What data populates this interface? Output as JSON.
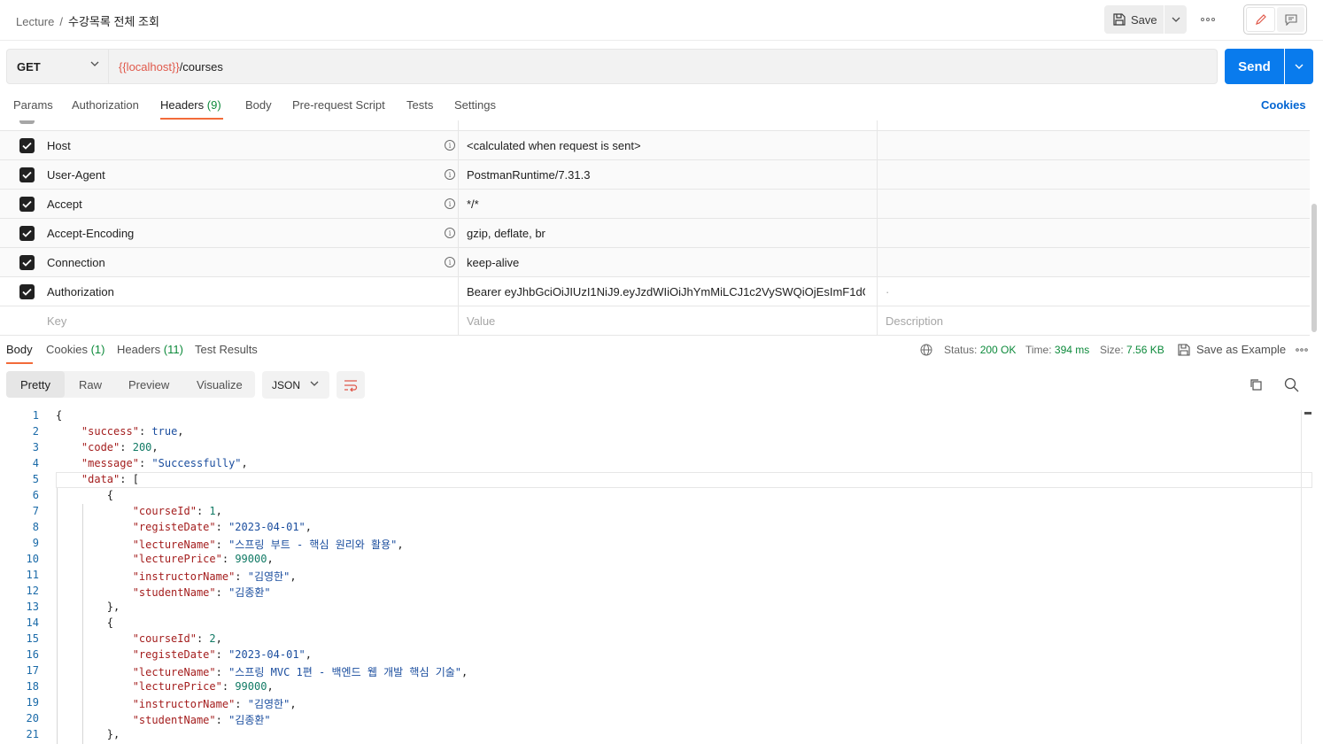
{
  "breadcrumb": {
    "parent": "Lecture",
    "separator": "/",
    "current": "수강목록 전체 조회"
  },
  "toolbar": {
    "save_label": "Save",
    "more": "ooo"
  },
  "request": {
    "method": "GET",
    "url_variable": "{{localhost}}",
    "url_path": "/courses",
    "send_label": "Send"
  },
  "request_tabs": {
    "params": "Params",
    "authorization": "Authorization",
    "headers": "Headers",
    "headers_count": "(9)",
    "body": "Body",
    "prerequest": "Pre-request Script",
    "tests": "Tests",
    "settings": "Settings",
    "cookies": "Cookies"
  },
  "headers": [
    {
      "key": "Host",
      "value": "<calculated when request is sent>",
      "description": ""
    },
    {
      "key": "User-Agent",
      "value": "PostmanRuntime/7.31.3",
      "description": ""
    },
    {
      "key": "Accept",
      "value": "*/*",
      "description": ""
    },
    {
      "key": "Accept-Encoding",
      "value": "gzip, deflate, br",
      "description": ""
    },
    {
      "key": "Connection",
      "value": "keep-alive",
      "description": ""
    },
    {
      "key": "Authorization",
      "value": "Bearer eyJhbGciOiJIUzI1NiJ9.eyJzdWIiOiJhYmMiLCJ1c2VySWQiOjEsImF1dGg",
      "description": "·"
    }
  ],
  "header_placeholders": {
    "key": "Key",
    "value": "Value",
    "description": "Description"
  },
  "response_tabs": {
    "body": "Body",
    "cookies": "Cookies",
    "cookies_count": "(1)",
    "headers": "Headers",
    "headers_count": "(11)",
    "test_results": "Test Results"
  },
  "response_status": {
    "status_label": "Status:",
    "status_value": "200 OK",
    "time_label": "Time:",
    "time_value": "394 ms",
    "size_label": "Size:",
    "size_value": "7.56 KB",
    "save_example": "Save as Example"
  },
  "format": {
    "pretty": "Pretty",
    "raw": "Raw",
    "preview": "Preview",
    "visualize": "Visualize",
    "language": "JSON"
  },
  "code_lines": [
    "{",
    "    \"success\": true,",
    "    \"code\": 200,",
    "    \"message\": \"Successfully\",",
    "    \"data\": [",
    "        {",
    "            \"courseId\": 1,",
    "            \"registeDate\": \"2023-04-01\",",
    "            \"lectureName\": \"스프링 부트 - 핵심 원리와 활용\",",
    "            \"lecturePrice\": 99000,",
    "            \"instructorName\": \"김영한\",",
    "            \"studentName\": \"김종환\"",
    "        },",
    "        {",
    "            \"courseId\": 2,",
    "            \"registeDate\": \"2023-04-01\",",
    "            \"lectureName\": \"스프링 MVC 1편 - 백엔드 웹 개발 핵심 기술\",",
    "            \"lecturePrice\": 99000,",
    "            \"instructorName\": \"김영한\",",
    "            \"studentName\": \"김종환\"",
    "        },"
  ],
  "colors": {
    "accent_tab": "#f26b3a",
    "send": "#097bed",
    "status_ok": "#0d8a3b",
    "variable": "#e0594b"
  }
}
